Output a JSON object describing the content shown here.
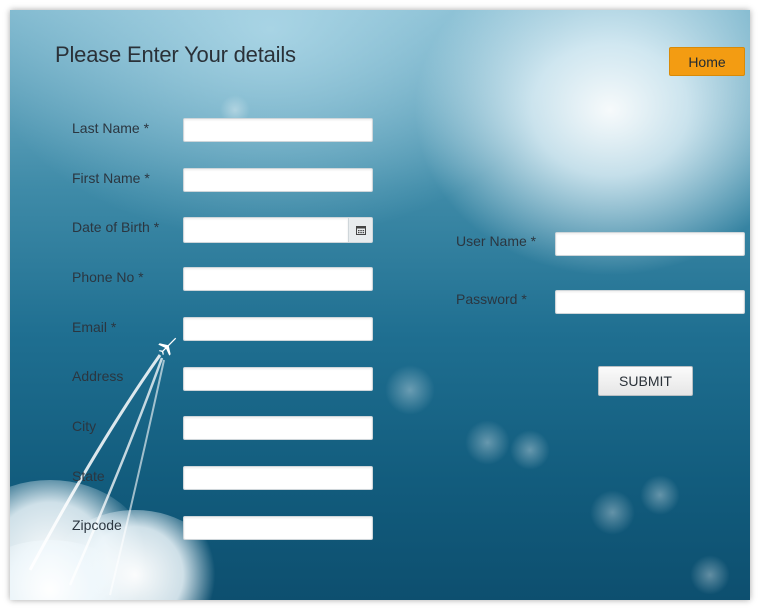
{
  "page": {
    "title": "Please Enter Your details"
  },
  "header": {
    "home_label": "Home",
    "home_color": "#f39c12"
  },
  "personal_form": {
    "last_name": {
      "label": "Last Name *",
      "value": ""
    },
    "first_name": {
      "label": "First Name *",
      "value": ""
    },
    "date_of_birth": {
      "label": "Date of Birth *",
      "value": "",
      "icon": "calendar-icon"
    },
    "phone_no": {
      "label": "Phone No *",
      "value": ""
    },
    "email": {
      "label": "Email *",
      "value": ""
    },
    "address": {
      "label": "Address",
      "value": ""
    },
    "city": {
      "label": "City",
      "value": ""
    },
    "state": {
      "label": "State",
      "value": ""
    },
    "zipcode": {
      "label": "Zipcode",
      "value": ""
    }
  },
  "account_form": {
    "user_name": {
      "label": "User Name *",
      "value": ""
    },
    "password": {
      "label": "Password *",
      "value": ""
    },
    "submit_label": "SUBMIT"
  },
  "decoration": {
    "background_icon": "airplane-icon"
  }
}
